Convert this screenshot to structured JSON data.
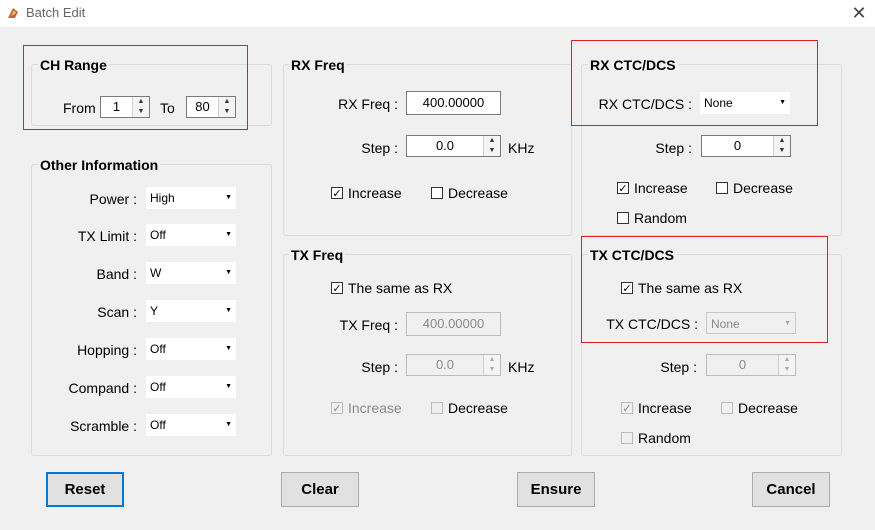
{
  "window": {
    "title": "Batch Edit",
    "close_glyph": "✕"
  },
  "ch_range": {
    "title": "CH Range",
    "from_label": "From",
    "from_value": "1",
    "to_label": "To",
    "to_value": "80"
  },
  "other_info": {
    "title": "Other Information",
    "rows": [
      {
        "label": "Power :",
        "value": "High"
      },
      {
        "label": "TX Limit :",
        "value": "Off"
      },
      {
        "label": "Band :",
        "value": "W"
      },
      {
        "label": "Scan :",
        "value": "Y"
      },
      {
        "label": "Hopping :",
        "value": "Off"
      },
      {
        "label": "Compand :",
        "value": "Off"
      },
      {
        "label": "Scramble :",
        "value": "Off"
      }
    ]
  },
  "rx_freq": {
    "title": "RX Freq",
    "freq_label": "RX Freq :",
    "freq_value": "400.00000",
    "step_label": "Step :",
    "step_value": "0.0",
    "unit": "KHz",
    "increase_label": "Increase",
    "increase_checked": true,
    "decrease_label": "Decrease",
    "decrease_checked": false
  },
  "tx_freq": {
    "title": "TX Freq",
    "same_label": "The same as RX",
    "same_checked": true,
    "freq_label": "TX Freq :",
    "freq_value": "400.00000",
    "step_label": "Step :",
    "step_value": "0.0",
    "unit": "KHz",
    "increase_label": "Increase",
    "increase_checked": true,
    "decrease_label": "Decrease",
    "decrease_checked": false
  },
  "rx_ctcdcs": {
    "title": "RX CTC/DCS",
    "label": "RX CTC/DCS :",
    "value": "None",
    "step_label": "Step :",
    "step_value": "0",
    "increase_label": "Increase",
    "increase_checked": true,
    "decrease_label": "Decrease",
    "decrease_checked": false,
    "random_label": "Random",
    "random_checked": false
  },
  "tx_ctcdcs": {
    "title": "TX CTC/DCS",
    "same_label": "The same as RX",
    "same_checked": true,
    "label": "TX CTC/DCS :",
    "value": "None",
    "step_label": "Step :",
    "step_value": "0",
    "increase_label": "Increase",
    "increase_checked": true,
    "decrease_label": "Decrease",
    "decrease_checked": false,
    "random_label": "Random",
    "random_checked": false
  },
  "buttons": {
    "reset": "Reset",
    "clear": "Clear",
    "ensure": "Ensure",
    "cancel": "Cancel"
  },
  "glyphs": {
    "up": "▲",
    "down": "▼",
    "check": "✓"
  },
  "colors": {
    "highlight_box": "#e02020",
    "focus": "#0078d7"
  }
}
